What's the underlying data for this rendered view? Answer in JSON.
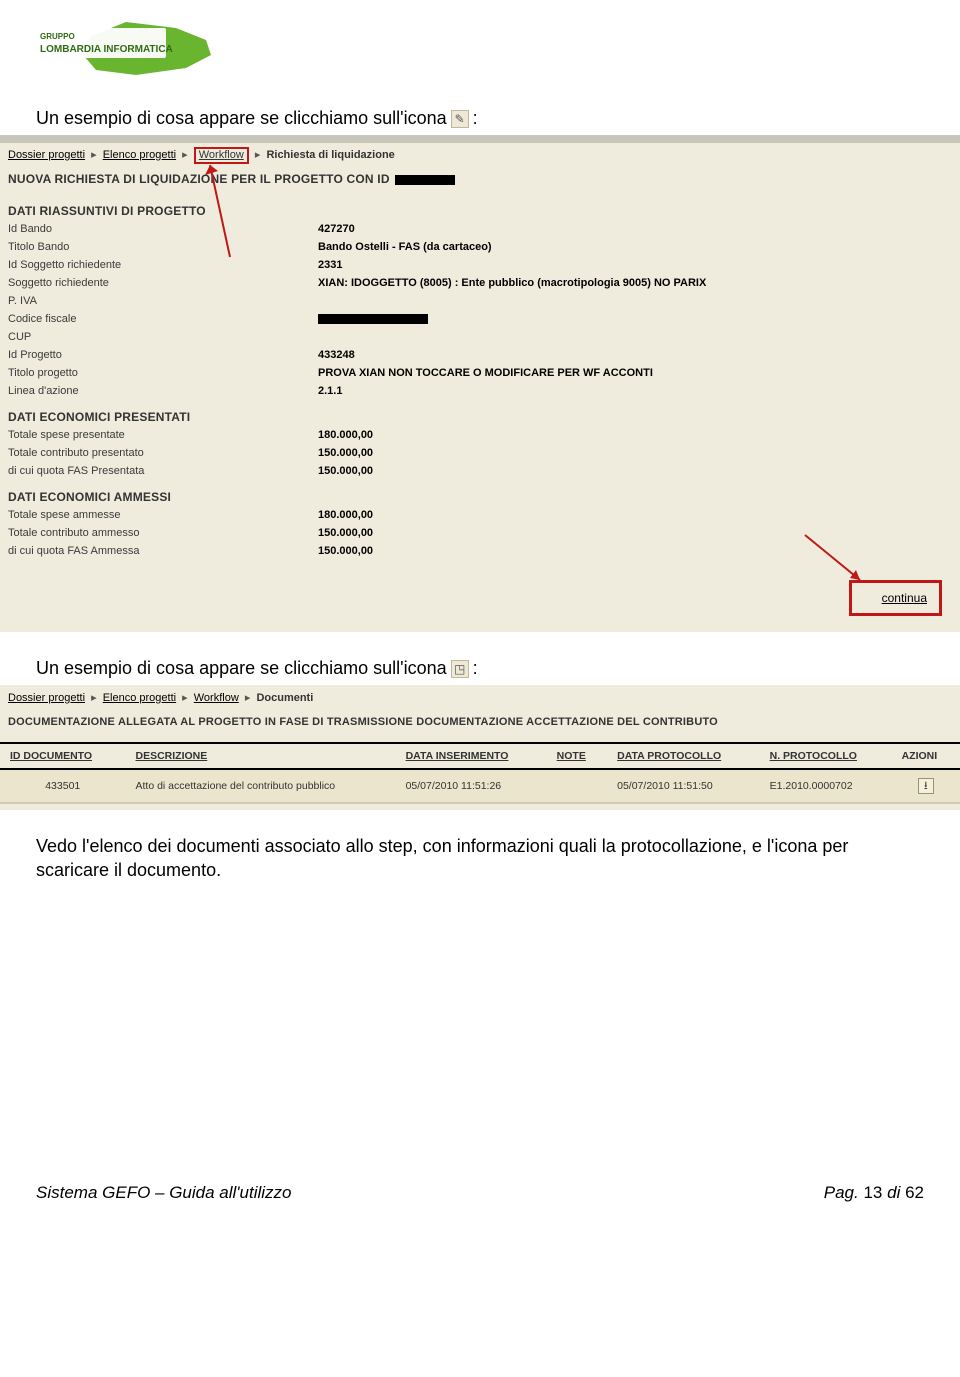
{
  "logo": {
    "line1": "GRUPPO",
    "line2": "LOMBARDIA INFORMATICA"
  },
  "intro1": {
    "prefix": "Un esempio di cosa appare se clicchiamo sull'icona ",
    "icon_glyph": "✎",
    "suffix": ":"
  },
  "shot1": {
    "breadcrumb": {
      "items": [
        "Dossier progetti",
        "Elenco progetti",
        "Workflow"
      ],
      "current": "Richiesta di liquidazione"
    },
    "title_prefix": "NUOVA RICHIESTA DI LIQUIDAZIONE PER IL PROGETTO CON ID",
    "section1": "DATI RIASSUNTIVI DI PROGETTO",
    "rows1": [
      {
        "label": "Id Bando",
        "value": "427270"
      },
      {
        "label": "Titolo Bando",
        "value": "Bando Ostelli - FAS (da cartaceo)"
      },
      {
        "label": "Id Soggetto richiedente",
        "value": "2331"
      },
      {
        "label": "Soggetto richiedente",
        "value": "XIAN: IDOGGETTO (8005) : Ente pubblico (macrotipologia 9005) NO PARIX"
      },
      {
        "label": "P. IVA",
        "value": ""
      },
      {
        "label": "Codice fiscale",
        "value": "__redacted__"
      },
      {
        "label": "CUP",
        "value": ""
      },
      {
        "label": "Id Progetto",
        "value": "433248"
      },
      {
        "label": "Titolo progetto",
        "value": "PROVA XIAN NON TOCCARE O MODIFICARE PER WF ACCONTI"
      },
      {
        "label": "Linea d'azione",
        "value": "2.1.1"
      }
    ],
    "section2": "DATI ECONOMICI PRESENTATI",
    "rows2": [
      {
        "label": "Totale spese presentate",
        "value": "180.000,00"
      },
      {
        "label": "Totale contributo presentato",
        "value": "150.000,00"
      },
      {
        "label": "di cui quota FAS Presentata",
        "value": "150.000,00"
      }
    ],
    "section3": "DATI ECONOMICI AMMESSI",
    "rows3": [
      {
        "label": "Totale spese ammesse",
        "value": "180.000,00"
      },
      {
        "label": "Totale contributo ammesso",
        "value": "150.000,00"
      },
      {
        "label": "di cui quota FAS Ammessa",
        "value": "150.000,00"
      }
    ],
    "continue_label": "continua"
  },
  "intro2": {
    "prefix": "Un esempio di cosa appare se clicchiamo sull'icona ",
    "icon_glyph": "◳",
    "suffix": ":"
  },
  "shot2": {
    "breadcrumb": {
      "items": [
        "Dossier progetti",
        "Elenco progetti",
        "Workflow"
      ],
      "current": "Documenti"
    },
    "title": "DOCUMENTAZIONE ALLEGATA AL PROGETTO IN FASE DI TRASMISSIONE DOCUMENTAZIONE ACCETTAZIONE DEL CONTRIBUTO",
    "headers": {
      "id": "ID DOCUMENTO",
      "descr": "DESCRIZIONE",
      "data_ins": "DATA INSERIMENTO",
      "note": "NOTE",
      "data_prot": "DATA PROTOCOLLO",
      "n_prot": "N. PROTOCOLLO",
      "azioni": "AZIONI"
    },
    "row": {
      "id": "433501",
      "descr": "Atto di accettazione del contributo pubblico",
      "data_ins": "05/07/2010 11:51:26",
      "note": "",
      "data_prot": "05/07/2010 11:51:50",
      "n_prot": "E1.2010.0000702"
    }
  },
  "paragraph": "Vedo l'elenco dei documenti associato allo step, con informazioni quali la protocollazione, e l'icona per scaricare il documento.",
  "footer": {
    "left": "Sistema GEFO – Guida all'utilizzo",
    "page_prefix": "Pag. ",
    "page_cur": "13",
    "page_sep": " di ",
    "page_tot": "62"
  }
}
